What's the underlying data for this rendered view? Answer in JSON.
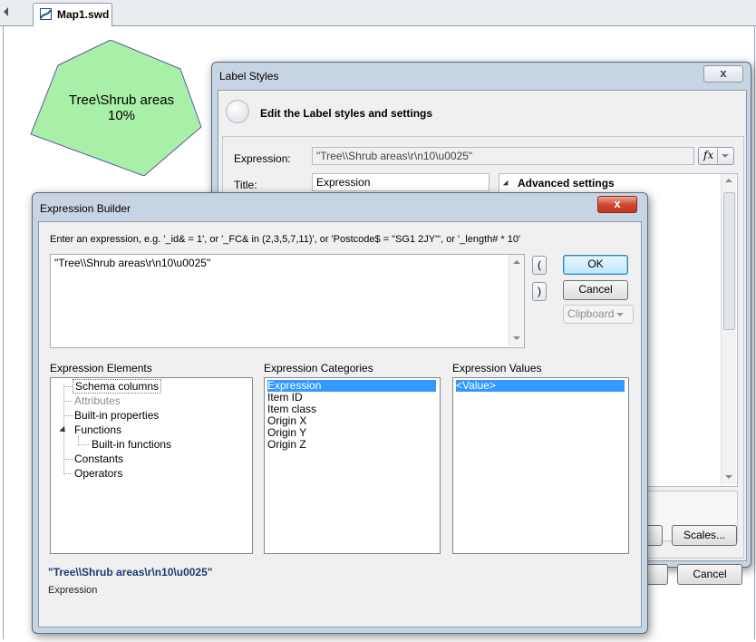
{
  "document_tab": {
    "label": "Map1.swd"
  },
  "map_feature": {
    "label_line1": "Tree\\Shrub areas",
    "label_line2": "10%",
    "fill_color": "#a8f0a8"
  },
  "label_styles": {
    "title": "Label Styles",
    "close": "x",
    "header": "Edit the Label styles and settings",
    "expression_label": "Expression:",
    "expression_value": "\"Tree\\\\Shrub areas\\r\\n10\\u0025\"",
    "fx_label": "fx",
    "title_label": "Title:",
    "title_value": "Expression",
    "advanced_settings": "Advanced settings",
    "scales_button": "Scales...",
    "cancel_button": "Cancel"
  },
  "expression_builder": {
    "title": "Expression Builder",
    "close": "x",
    "prompt": "Enter an expression, e.g. '_id& = 1', or '_FC& in (2,3,5,7,11)', or 'Postcode$ = \"SG1 2JY\"', or '_length# * 10'",
    "expression_text": "\"Tree\\\\Shrub areas\\r\\n10\\u0025\"",
    "lparen": "(",
    "rparen": ")",
    "ok_button": "OK",
    "cancel_button": "Cancel",
    "clipboard_button": "Clipboard",
    "elements_label": "Expression Elements",
    "categories_label": "Expression Categories",
    "values_label": "Expression Values",
    "elements": [
      {
        "label": "Schema columns"
      },
      {
        "label": "Attributes"
      },
      {
        "label": "Built-in properties"
      },
      {
        "label": "Functions"
      },
      {
        "label": "Built-in functions"
      },
      {
        "label": "Constants"
      },
      {
        "label": "Operators"
      }
    ],
    "categories": [
      "Expression",
      "Item ID",
      "Item class",
      "Origin X",
      "Origin Y",
      "Origin Z"
    ],
    "selected_category": "Expression",
    "values": [
      "<Value>"
    ],
    "result_text": "\"Tree\\\\Shrub areas\\r\\n10\\u0025\"",
    "result_category": "Expression"
  }
}
